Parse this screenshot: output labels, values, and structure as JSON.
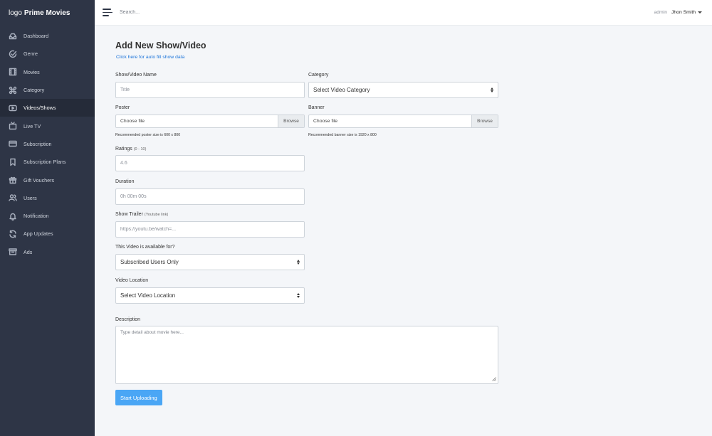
{
  "app": {
    "logo_prefix": "logo",
    "brand": "Prime Movies"
  },
  "sidebar": {
    "items": [
      {
        "label": "Dashboard",
        "icon": "dashboard-icon"
      },
      {
        "label": "Genre",
        "icon": "genre-icon"
      },
      {
        "label": "Movies",
        "icon": "movies-icon"
      },
      {
        "label": "Category",
        "icon": "category-icon"
      },
      {
        "label": "Videos/Shows",
        "icon": "video-icon",
        "active": true
      },
      {
        "label": "Live TV",
        "icon": "tv-icon"
      },
      {
        "label": "Subscription",
        "icon": "subscription-icon"
      },
      {
        "label": "Subscription Plans",
        "icon": "bookmark-icon"
      },
      {
        "label": "Gift Vouchers",
        "icon": "gift-icon"
      },
      {
        "label": "Users",
        "icon": "users-icon"
      },
      {
        "label": "Notification",
        "icon": "bell-icon"
      },
      {
        "label": "App Updates",
        "icon": "refresh-icon"
      },
      {
        "label": "Ads",
        "icon": "ads-icon"
      }
    ]
  },
  "topbar": {
    "search_placeholder": "Search...",
    "user_role": "admin",
    "user_name": "Jhon Smith"
  },
  "form": {
    "title": "Add New Show/Video",
    "autofill_link": "Click here for auto fill show data",
    "name_label": "Show/Video Name",
    "name_placeholder": "Title",
    "category_label": "Category",
    "category_value": "Select Video Category",
    "poster_label": "Poster",
    "poster_file": "Choose file",
    "poster_browse": "Browse",
    "poster_hint": "Recommended poster size is 600 x 800",
    "banner_label": "Banner",
    "banner_file": "Choose file",
    "banner_browse": "Browse",
    "banner_hint": "Recommended banner size is 1920 x 800",
    "ratings_label": "Ratings",
    "ratings_hint": "(0 - 10)",
    "ratings_placeholder": "4.6",
    "duration_label": "Duration",
    "duration_placeholder": "0h 00m 00s",
    "trailer_label": "Show Trailer",
    "trailer_hint": "(Youtube link)",
    "trailer_placeholder": "https://youtu.be/watch=...",
    "availability_label": "This Video is available for?",
    "availability_value": "Subscribed Users Only",
    "location_label": "Video Location",
    "location_value": "Select Video Location",
    "description_label": "Description",
    "description_placeholder": "Type detail about movie here...",
    "submit_label": "Start Uploading"
  }
}
